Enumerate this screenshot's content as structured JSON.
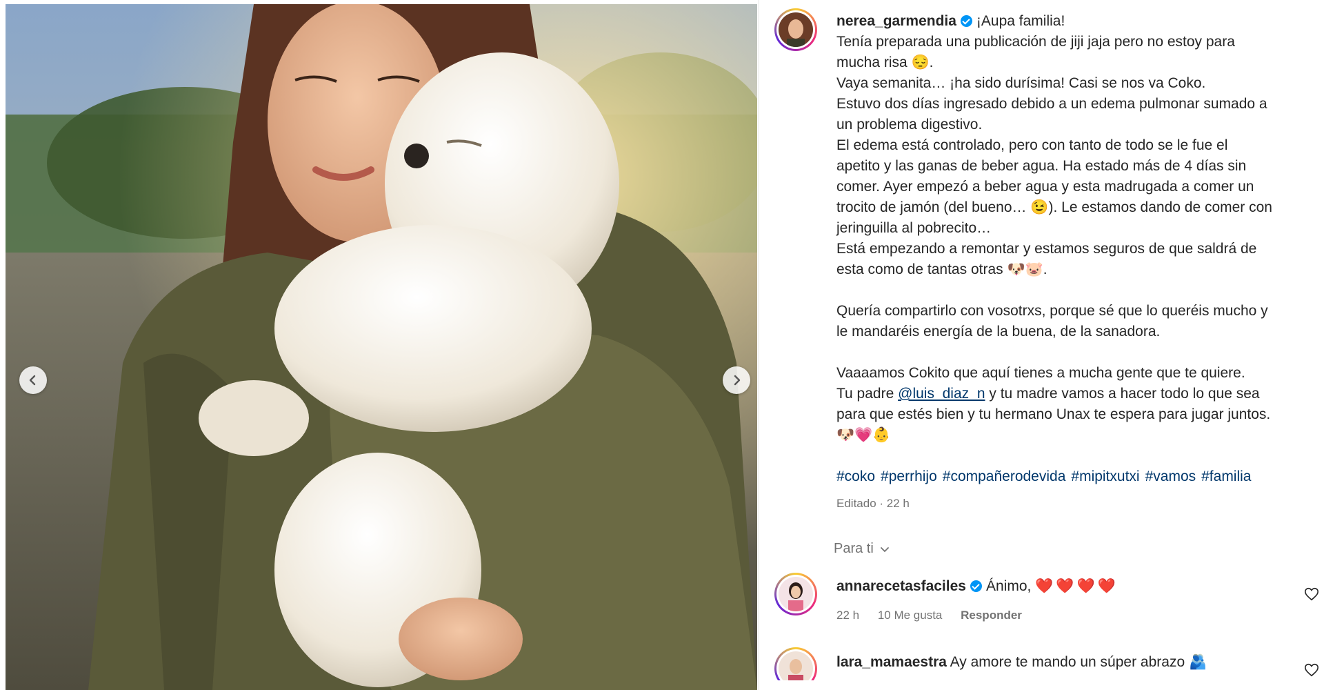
{
  "post": {
    "username": "nerea_garmendia",
    "lines": [
      "¡Aupa familia!",
      "Tenía preparada una publicación de jiji jaja pero no estoy para",
      "mucha risa 😔.",
      "Vaya semanita… ¡ha sido durísima! Casi se nos va Coko.",
      "Estuvo dos días ingresado debido a un edema pulmonar sumado a",
      "un problema digestivo.",
      "El edema está controlado, pero con tanto de todo se le fue el",
      "apetito y las ganas de beber agua. Ha estado más de 4 días sin",
      "comer. Ayer empezó a beber agua y esta madrugada a comer un",
      "trocito de jamón (del bueno… 😉). Le estamos dando de comer con",
      "jeringuilla al pobrecito…",
      "Está empezando a remontar y estamos seguros de que saldrá de",
      "esta como de tantas otras 🐶🐷.",
      "Quería compartirlo con vosotrxs, porque sé que lo queréis mucho y",
      "le mandaréis energía de la buena, de la sanadora.",
      "Vaaaamos Cokito que aquí tienes a mucha gente que te quiere.",
      "Tu padre",
      "@luis_diaz_n",
      "y tu madre vamos a hacer todo lo que sea",
      "para que estés bien y tu hermano Unax te espera para jugar juntos.",
      "🐶💗👶"
    ],
    "hashtags": [
      "#coko",
      "#perrhijo",
      "#compañerodevida",
      "#mipitxutxi",
      "#vamos",
      "#familia"
    ],
    "edited": "Editado · 22 h"
  },
  "filter": {
    "label": "Para ti"
  },
  "comments": [
    {
      "username": "annarecetasfaciles",
      "text": "Ánimo,",
      "hearts": "❤️❤️❤️❤️",
      "time": "22 h",
      "likes": "10 Me gusta",
      "reply": "Responder"
    },
    {
      "username": "lara_mamaestra",
      "text": "Ay amore te mando un súper abrazo 🫂"
    }
  ]
}
